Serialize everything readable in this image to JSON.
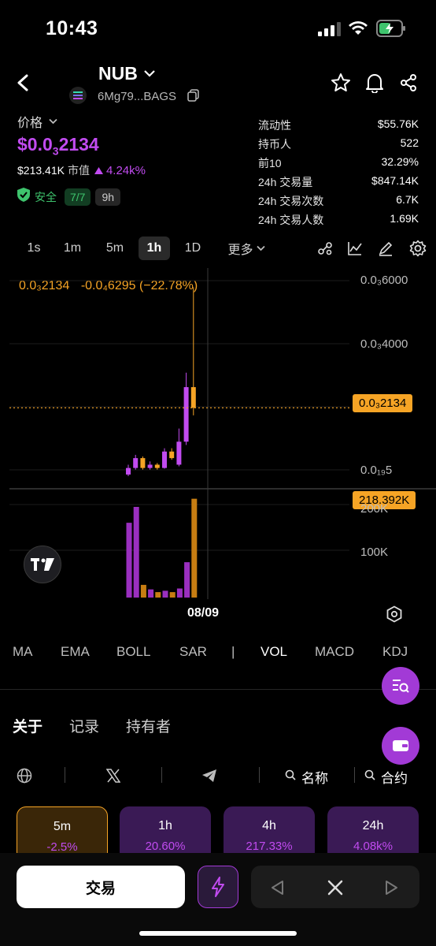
{
  "status_bar": {
    "time": "10:43"
  },
  "header": {
    "token_name": "NUB",
    "address": "6Mg79...BAGS"
  },
  "price_block": {
    "label": "价格",
    "price_main": "$0.0",
    "price_sub": "3",
    "price_tail": "2134",
    "market_cap": "$213.41K",
    "market_cap_label": "市值",
    "change": "4.24k%",
    "safety_label": "安全",
    "safety_score": "7/7",
    "age": "9h"
  },
  "stats": [
    {
      "label": "流动性",
      "value": "$55.76K"
    },
    {
      "label": "持币人",
      "value": "522"
    },
    {
      "label": "前10",
      "value": "32.29%"
    },
    {
      "label": "24h 交易量",
      "value": "$847.14K"
    },
    {
      "label": "24h 交易次数",
      "value": "6.7K"
    },
    {
      "label": "24h 交易人数",
      "value": "1.69K"
    }
  ],
  "timeframes": [
    "1s",
    "1m",
    "5m",
    "1h",
    "1D",
    "更多"
  ],
  "active_timeframe": "1h",
  "chart_data": {
    "type": "candlestick",
    "header_price": "0.0₃2134",
    "header_change": "-0.0₄6295 (−22.78%)",
    "y_ticks": [
      "0.0₃6000",
      "0.0₃4000",
      "0.0₁₉5"
    ],
    "current_price_label": "0.0₃2134",
    "volume_ticks": [
      "200K",
      "100K"
    ],
    "current_volume_label": "218.392K",
    "x_label": "08/09",
    "candles": [
      {
        "open": 1e-05,
        "close": 3e-05,
        "high": 4e-05,
        "low": 5e-06,
        "dir": "up"
      },
      {
        "open": 3e-05,
        "close": 6e-05,
        "high": 7e-05,
        "low": 2.5e-05,
        "dir": "up"
      },
      {
        "open": 6e-05,
        "close": 3e-05,
        "high": 6.5e-05,
        "low": 2.5e-05,
        "dir": "down"
      },
      {
        "open": 3e-05,
        "close": 4e-05,
        "high": 5e-05,
        "low": 2.5e-05,
        "dir": "up"
      },
      {
        "open": 4e-05,
        "close": 3e-05,
        "high": 4.5e-05,
        "low": 2.5e-05,
        "dir": "down"
      },
      {
        "open": 3e-05,
        "close": 8e-05,
        "high": 9e-05,
        "low": 2.8e-05,
        "dir": "up"
      },
      {
        "open": 8e-05,
        "close": 6e-05,
        "high": 9e-05,
        "low": 5.5e-05,
        "dir": "down"
      },
      {
        "open": 4e-05,
        "close": 0.00011,
        "high": 0.00015,
        "low": 3.5e-05,
        "dir": "up"
      },
      {
        "open": 0.00011,
        "close": 0.000276,
        "high": 0.00032,
        "low": 0.0001,
        "dir": "up"
      },
      {
        "open": 0.000276,
        "close": 0.000213,
        "high": 0.00058,
        "low": 0.00019,
        "dir": "down"
      }
    ],
    "volumes": [
      165,
      200,
      28,
      18,
      12,
      15,
      12,
      20,
      78,
      218
    ],
    "y_range": [
      1.95e-05,
      0.0006
    ],
    "volume_max": 240
  },
  "indicators": [
    "MA",
    "EMA",
    "BOLL",
    "SAR",
    "|",
    "VOL",
    "MACD",
    "KDJ"
  ],
  "active_indicator": "VOL",
  "tabs": [
    "关于",
    "记录",
    "持有者"
  ],
  "links": {
    "name_label": "名称",
    "contract_label": "合约"
  },
  "period_cards": [
    {
      "label": "5m",
      "value": "-2.5%"
    },
    {
      "label": "1h",
      "value": "20.60%"
    },
    {
      "label": "4h",
      "value": "217.33%"
    },
    {
      "label": "24h",
      "value": "4.08k%"
    }
  ],
  "bottom": {
    "trade_label": "交易"
  },
  "colors": {
    "accent": "#c14bf0",
    "up": "#c14bf0",
    "down": "#f6a425",
    "safe": "#3ec46d"
  }
}
